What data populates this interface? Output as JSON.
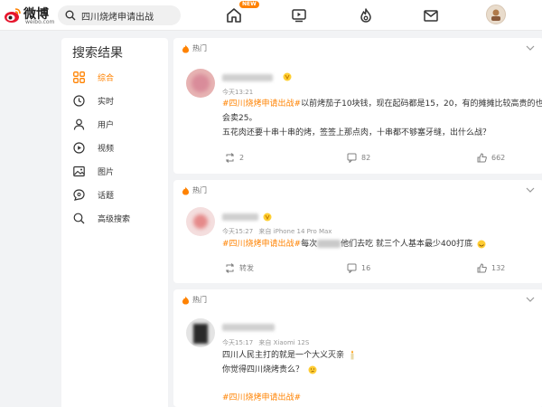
{
  "brand": {
    "name": "微博",
    "domain": "weibo.com"
  },
  "search": {
    "query": "四川烧烤申请出战"
  },
  "nav": {
    "new_badge": "NEW"
  },
  "sidebar": {
    "title": "搜索结果",
    "items": [
      {
        "label": "综合",
        "icon": "grid-icon",
        "active": true
      },
      {
        "label": "实时",
        "icon": "clock-icon"
      },
      {
        "label": "用户",
        "icon": "user-icon"
      },
      {
        "label": "视频",
        "icon": "video-icon"
      },
      {
        "label": "图片",
        "icon": "image-icon"
      },
      {
        "label": "话题",
        "icon": "topic-icon"
      },
      {
        "label": "高级搜索",
        "icon": "search-icon"
      }
    ]
  },
  "posts": [
    {
      "tag": "热门",
      "time": "今天13:21",
      "hashtag": "#四川烧烤申请出战#",
      "line1_rest": "以前烤茄子10块钱，现在起码都是15，20，有的摊摊比较高贵的也",
      "line2": "会卖25。",
      "line3": "五花肉还要十串十串的烤，签签上那点肉，十串都不够塞牙缝，出什么战？",
      "repost": "2",
      "comments": "82",
      "likes": "662"
    },
    {
      "tag": "热门",
      "time": "今天15:27",
      "source": "来自 iPhone 14 Pro Max",
      "hashtag": "#四川烧烤申请出战#",
      "text_a": "每次",
      "text_b": "他们去吃 就三个人基本最少400打底",
      "repost": "转发",
      "comments": "16",
      "likes": "132"
    },
    {
      "tag": "热门",
      "time": "今天15:17",
      "source": "来自 Xiaomi 12S",
      "line1": "四川人民主打的就是一个大义灭亲",
      "line2": "你觉得四川烧烤贵么？",
      "hashtag": "#四川烧烤申请出战#"
    }
  ],
  "colors": {
    "accent": "#ff8200",
    "background": "#f2f3f5"
  }
}
